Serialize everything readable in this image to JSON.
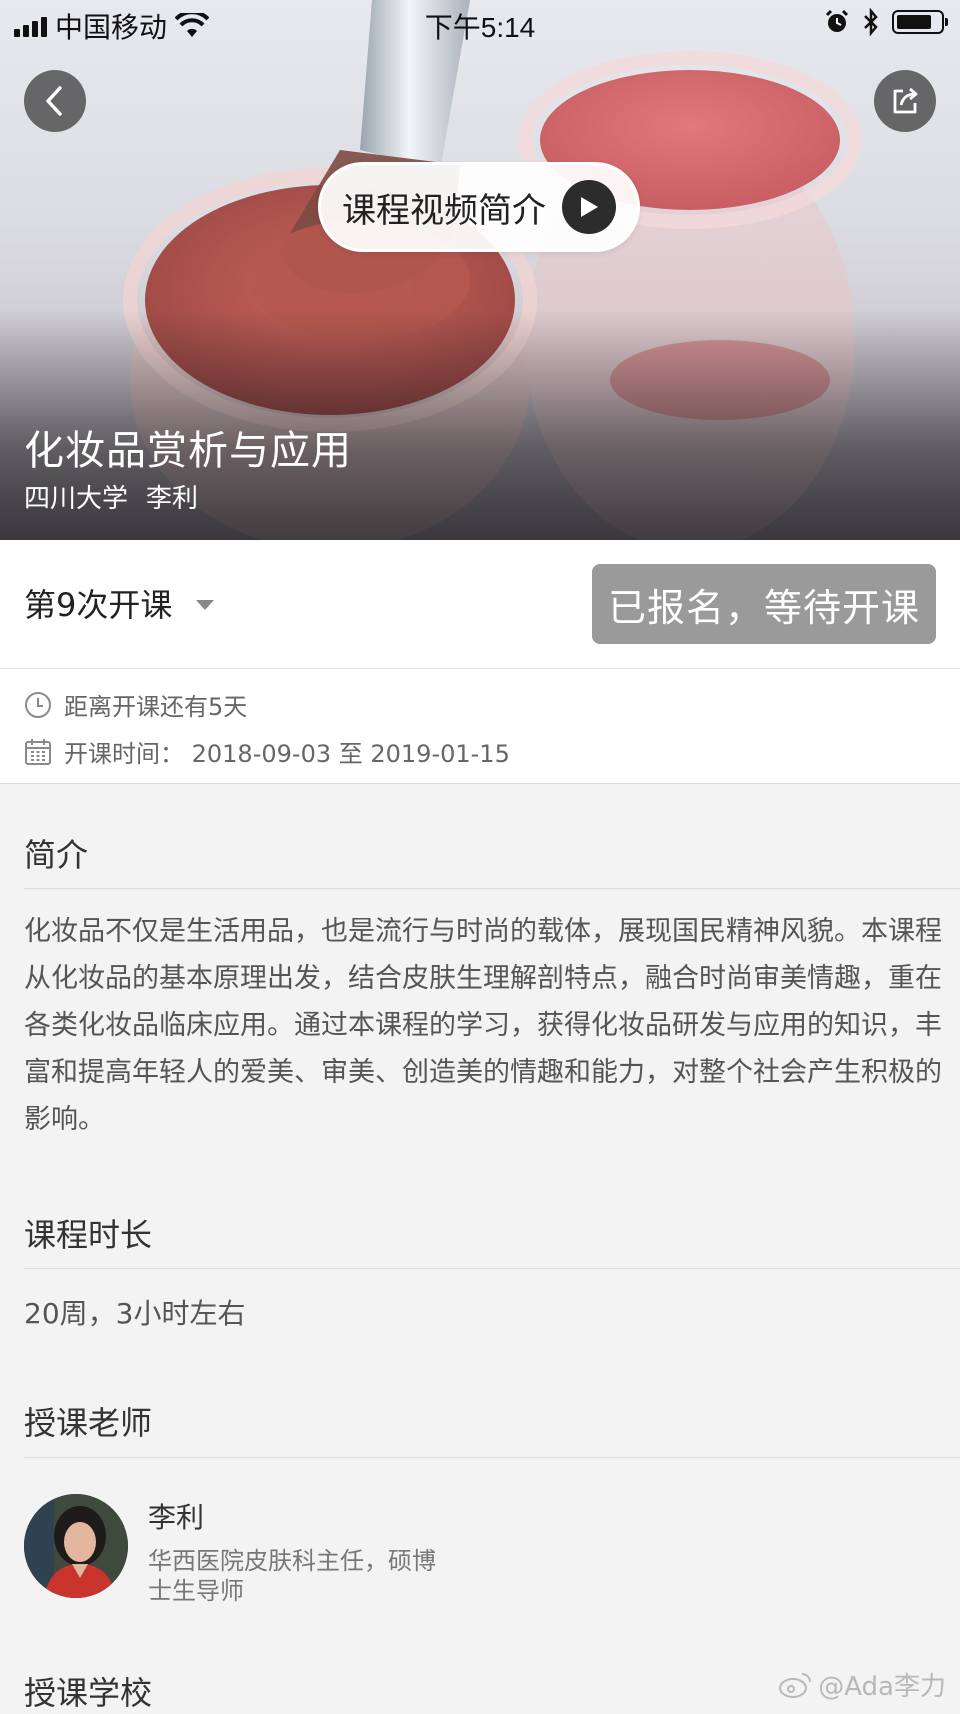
{
  "status_bar": {
    "carrier": "中国移动",
    "time": "下午5:14",
    "icons": [
      "signal-icon",
      "wifi-icon",
      "alarm-icon",
      "bluetooth-icon",
      "battery-icon"
    ]
  },
  "hero": {
    "video_button_label": "课程视频简介",
    "course_title": "化妆品赏析与应用",
    "university": "四川大学",
    "teacher": "李利"
  },
  "session": {
    "selector_label": "第9次开课",
    "status_button_label": "已报名，等待开课",
    "countdown_text": "距离开课还有5天",
    "schedule_text": "开课时间：  2018-09-03 至 2019-01-15"
  },
  "intro": {
    "title": "简介",
    "body": "化妆品不仅是生活用品，也是流行与时尚的载体，展现国民精神风貌。本课程从化妆品的基本原理出发，结合皮肤生理解剖特点，融合时尚审美情趣，重在各类化妆品临床应用。通过本课程的学习，获得化妆品研发与应用的知识，丰富和提高年轻人的爱美、审美、创造美的情趣和能力，对整个社会产生积极的影响。"
  },
  "duration": {
    "title": "课程时长",
    "value": "20周，3小时左右"
  },
  "instructor": {
    "title": "授课老师",
    "name": "李利",
    "description_line1": "华西医院皮肤科主任，硕博",
    "description_line2": "士生导师"
  },
  "school": {
    "title": "授课学校"
  },
  "watermark": "@Ada李力",
  "colors": {
    "status_button_bg": "#9a9a9a",
    "page_bg": "#f3f3f3"
  }
}
